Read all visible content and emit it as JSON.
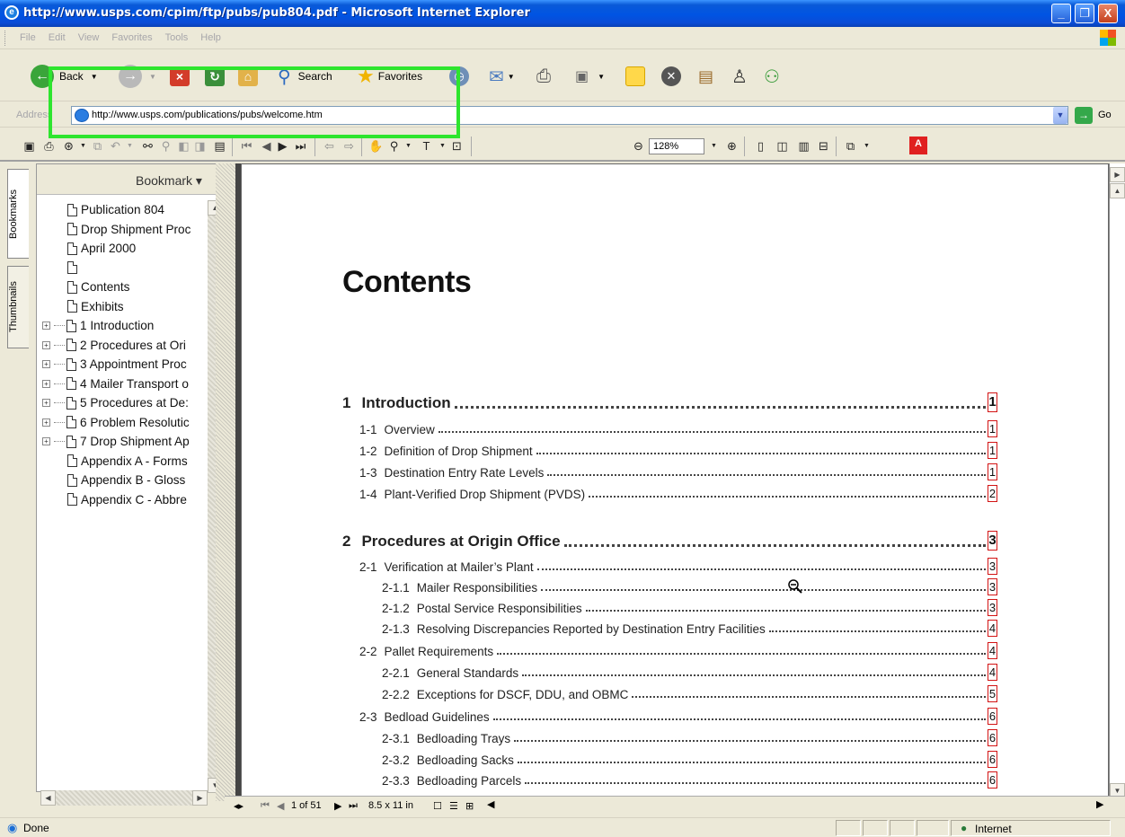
{
  "window": {
    "title": "http://www.usps.com/cpim/ftp/pubs/pub804.pdf - Microsoft Internet Explorer",
    "minimize": "_",
    "maximize": "❐",
    "close": "X"
  },
  "menu": [
    "File",
    "Edit",
    "View",
    "Favorites",
    "Tools",
    "Help"
  ],
  "toolbar": {
    "back": "Back",
    "search": "Search",
    "favorites": "Favorites"
  },
  "address": {
    "label": "Address",
    "url": "http://www.usps.com/publications/pubs/welcome.htm",
    "go": "Go"
  },
  "acrobat": {
    "zoom": "128%"
  },
  "nav": {
    "tabs": [
      "Bookmarks",
      "Thumbnails"
    ],
    "header": "Bookmark ▾",
    "bookmarks": [
      {
        "label": "Publication 804",
        "expandable": false
      },
      {
        "label": "Drop Shipment Proc",
        "expandable": false
      },
      {
        "label": "April 2000",
        "expandable": false
      },
      {
        "label": "",
        "expandable": false
      },
      {
        "label": "Contents",
        "expandable": false
      },
      {
        "label": "Exhibits",
        "expandable": false
      },
      {
        "label": "1 Introduction",
        "expandable": true
      },
      {
        "label": "2 Procedures at Ori",
        "expandable": true
      },
      {
        "label": "3 Appointment Proc",
        "expandable": true
      },
      {
        "label": "4 Mailer Transport o",
        "expandable": true
      },
      {
        "label": "5 Procedures at De:",
        "expandable": true
      },
      {
        "label": "6 Problem Resolutic",
        "expandable": true
      },
      {
        "label": "7 Drop Shipment Ap",
        "expandable": true
      },
      {
        "label": "Appendix A - Forms",
        "expandable": false
      },
      {
        "label": "Appendix B - Gloss",
        "expandable": false
      },
      {
        "label": "Appendix C - Abbre",
        "expandable": false
      }
    ]
  },
  "document": {
    "title": "Contents",
    "toc": [
      {
        "level": 1,
        "num": "1",
        "text": "Introduction",
        "page": "1"
      },
      {
        "level": 2,
        "num": "1-1",
        "text": "Overview",
        "page": "1"
      },
      {
        "level": 2,
        "num": "1-2",
        "text": "Definition of Drop Shipment",
        "page": "1"
      },
      {
        "level": 2,
        "num": "1-3",
        "text": "Destination Entry Rate Levels",
        "page": "1"
      },
      {
        "level": 2,
        "num": "1-4",
        "text": "Plant-Verified Drop Shipment (PVDS)",
        "page": "2"
      },
      {
        "level": 1,
        "num": "2",
        "text": "Procedures at Origin Office",
        "page": "3"
      },
      {
        "level": 2,
        "num": "2-1",
        "text": "Verification at Mailer’s Plant",
        "page": "3"
      },
      {
        "level": 3,
        "num": "2-1.1",
        "text": "Mailer Responsibilities",
        "page": "3"
      },
      {
        "level": 3,
        "num": "2-1.2",
        "text": "Postal Service Responsibilities",
        "page": "3"
      },
      {
        "level": 3,
        "num": "2-1.3",
        "text": "Resolving Discrepancies Reported by Destination Entry Facilities",
        "page": "4"
      },
      {
        "level": 2,
        "num": "2-2",
        "text": "Pallet Requirements",
        "page": "4"
      },
      {
        "level": 3,
        "num": "2-2.1",
        "text": "General Standards",
        "page": "4"
      },
      {
        "level": 3,
        "num": "2-2.2",
        "text": "Exceptions for DSCF, DDU, and OBMC",
        "page": "5"
      },
      {
        "level": 2,
        "num": "2-3",
        "text": "Bedload Guidelines",
        "page": "6"
      },
      {
        "level": 3,
        "num": "2-3.1",
        "text": "Bedloading Trays",
        "page": "6"
      },
      {
        "level": 3,
        "num": "2-3.2",
        "text": "Bedloading Sacks",
        "page": "6"
      },
      {
        "level": 3,
        "num": "2-3.3",
        "text": "Bedloading Parcels",
        "page": "6"
      }
    ]
  },
  "docnav": {
    "page_of": "1 of 51",
    "page_size": "8.5 x 11 in"
  },
  "status": {
    "text": "Done",
    "zone": "Internet"
  },
  "colors": {
    "highlight": "#2ee52e",
    "link_box": "#d21414",
    "titlebar": "#0054e3"
  }
}
